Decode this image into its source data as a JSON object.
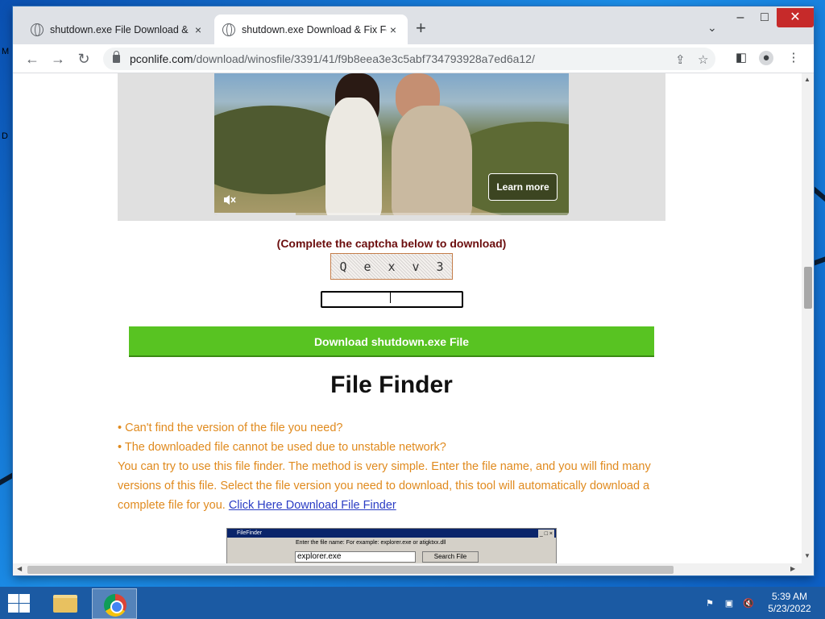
{
  "desktop": {
    "marks": [
      "M",
      "D"
    ]
  },
  "browser": {
    "tabs": [
      {
        "title": "shutdown.exe File Download & Fix For",
        "close": "×",
        "active": false
      },
      {
        "title": "shutdown.exe Download & Fix For",
        "close": "×",
        "active": true
      }
    ],
    "new_tab": "+",
    "tab_search": "⌄",
    "window_controls": {
      "minimize": "–",
      "maximize": "□",
      "close": "✕"
    },
    "nav": {
      "back": "←",
      "forward": "→",
      "reload": "↻"
    },
    "url_domain": "pconlife.com",
    "url_path": "/download/winosfile/3391/41/f9b8eea3e3c5abf734793928a7ed6a12/"
  },
  "ad": {
    "learn_more": "Learn more",
    "progress_fraction": 0.23
  },
  "captcha": {
    "prompt": "(Complete the captcha below to download)",
    "chars": [
      "Q",
      "e",
      "x",
      "v",
      "3"
    ],
    "input_value": ""
  },
  "download_button": "Download shutdown.exe File",
  "file_finder": {
    "title": "File Finder",
    "bullet1": "• Can't find the version of the file you need?",
    "bullet2": "• The downloaded file cannot be used due to unstable network?",
    "paragraph": "You can try to use this file finder. The method is very simple. Enter the file name, and you will find many versions of this file. Select the file version you need to download, this tool will automatically download a complete file for you.",
    "link": "Click Here Download File Finder",
    "preview": {
      "title": "FileFinder",
      "controls": "_ □ ×",
      "label": "Enter the file name:   For example: explorer.exe or atigktxx.dll",
      "input_value": "explorer.exe",
      "button": "Search File"
    }
  },
  "taskbar": {
    "time": "5:39 AM",
    "date": "5/23/2022"
  }
}
